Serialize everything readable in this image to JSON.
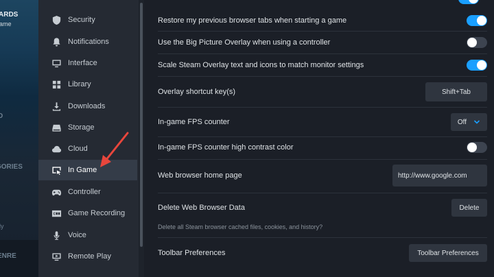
{
  "background": {
    "texts": [
      "ARDS",
      "ame",
      "D",
      "GORIES",
      "dy",
      "ENRE"
    ]
  },
  "sidebar": {
    "items": [
      {
        "label": "Security",
        "icon": "shield-icon"
      },
      {
        "label": "Notifications",
        "icon": "bell-icon"
      },
      {
        "label": "Interface",
        "icon": "monitor-icon"
      },
      {
        "label": "Library",
        "icon": "grid-icon"
      },
      {
        "label": "Downloads",
        "icon": "download-icon"
      },
      {
        "label": "Storage",
        "icon": "drive-icon"
      },
      {
        "label": "Cloud",
        "icon": "cloud-icon"
      },
      {
        "label": "In Game",
        "icon": "ingame-icon",
        "active": true
      },
      {
        "label": "Controller",
        "icon": "gamepad-icon"
      },
      {
        "label": "Game Recording",
        "icon": "rec-icon"
      },
      {
        "label": "Voice",
        "icon": "microphone-icon"
      },
      {
        "label": "Remote Play",
        "icon": "remote-play-icon"
      }
    ]
  },
  "settings": {
    "restore_tabs": {
      "label": "Restore my previous browser tabs when starting a game",
      "state": "on"
    },
    "big_picture_overlay": {
      "label": "Use the Big Picture Overlay when using a controller",
      "state": "off"
    },
    "scale_overlay": {
      "label": "Scale Steam Overlay text and icons to match monitor settings",
      "state": "on"
    },
    "shortcut": {
      "label": "Overlay shortcut key(s)",
      "value": "Shift+Tab"
    },
    "fps_counter": {
      "label": "In-game FPS counter",
      "value": "Off"
    },
    "fps_contrast": {
      "label": "In-game FPS counter high contrast color",
      "state": "off"
    },
    "home_page": {
      "label": "Web browser home page",
      "value": "http://www.google.com"
    },
    "delete_data": {
      "label": "Delete Web Browser Data",
      "button": "Delete",
      "description": "Delete all Steam browser cached files, cookies, and history?"
    },
    "toolbar": {
      "label": "Toolbar Preferences",
      "button": "Toolbar Preferences"
    }
  },
  "colors": {
    "accent": "#1a9fff",
    "annotation_arrow": "#e8463c"
  }
}
